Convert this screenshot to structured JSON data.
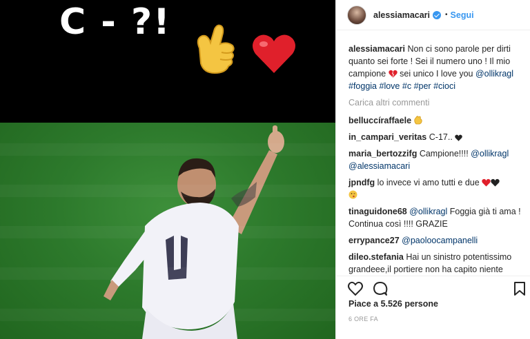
{
  "post": {
    "overlay_text": "C - ?!",
    "username": "alessiamacari",
    "dot": "•",
    "follow_label": "Segui",
    "caption": {
      "username": "alessiamacari",
      "text": "Non ci sono parole per dirti quanto sei forte ! Sei il numero uno ! Il mio campione ",
      "text2": " sei unico I love you ",
      "mention": "@ollikragl",
      "tags": [
        "#foggia",
        "#love",
        "#c",
        "#per",
        "#cioci"
      ]
    },
    "load_more": "Carica altri commenti",
    "comments": [
      {
        "user": "belluccíraffaele",
        "text": ""
      },
      {
        "user": "in_campari_veritas",
        "text": "C-17.."
      },
      {
        "user": "maria_bertozzifg",
        "text": "Campione!!!! ",
        "mention": "@ollikragl",
        "mention2": "@alessiamacari"
      },
      {
        "user": "jpndfg",
        "text": "lo invece vi amo tutti e due "
      },
      {
        "user": "tinaguidone68",
        "mention": "@ollikragl",
        "text": " Foggia già ti ama ! Continua così !!!! GRAZIE"
      },
      {
        "user": "errypance27",
        "mention": "@paoloocampanelli",
        "text": ""
      },
      {
        "user": "dileo.stefania",
        "text": "Hai un sinistro potentissimo grandeee,il portiere non ha capito niente bravissimo Holly "
      }
    ],
    "likes": "Piace a 5.526 persone",
    "time": "6 ORE FA"
  },
  "colors": {
    "accent": "#3897f0",
    "link": "#003569",
    "heart": "#e0202b",
    "pitch": "#2d7a2c"
  },
  "icons": [
    "heart-icon",
    "comment-icon",
    "bookmark-icon",
    "verified-badge-icon"
  ]
}
